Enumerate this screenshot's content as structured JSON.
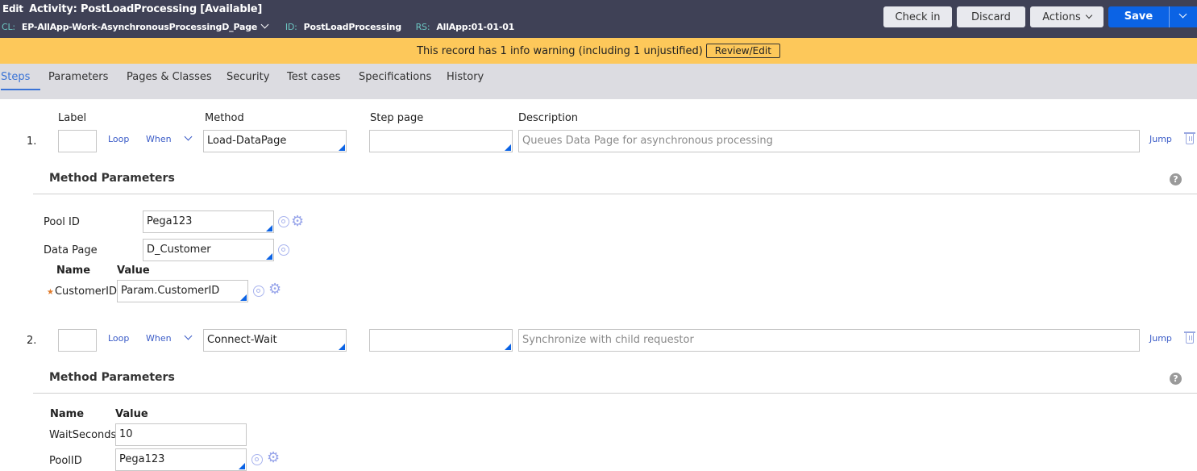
{
  "header": {
    "edit_label": "Edit",
    "title": "Activity: PostLoadProcessing [Available]",
    "cl_key": "CL:",
    "cl_value": "EP-AllApp-Work-AsynchronousProcessingD_Page",
    "id_key": "ID:",
    "id_value": "PostLoadProcessing",
    "rs_key": "RS:",
    "rs_value": "AllApp:01-01-01",
    "buttons": {
      "check_in": "Check in",
      "discard": "Discard",
      "actions": "Actions",
      "save": "Save"
    },
    "colors": {
      "background": "#3f4156",
      "save": "#0b63e5"
    }
  },
  "warning": {
    "text": "This record has 1 info warning (including 1 unjustified)",
    "button": "Review/Edit",
    "color": "#fdc85a"
  },
  "tabs": [
    {
      "label": "Steps",
      "active": true
    },
    {
      "label": "Parameters",
      "active": false
    },
    {
      "label": "Pages & Classes",
      "active": false
    },
    {
      "label": "Security",
      "active": false
    },
    {
      "label": "Test cases",
      "active": false
    },
    {
      "label": "Specifications",
      "active": false
    },
    {
      "label": "History",
      "active": false
    }
  ],
  "columns": {
    "label": "Label",
    "method": "Method",
    "step_page": "Step page",
    "description": "Description"
  },
  "steps": [
    {
      "number": "1.",
      "label_value": "",
      "loop": "Loop",
      "when": "When",
      "method": "Load-DataPage",
      "step_page": "",
      "description_placeholder": "Queues Data Page for asynchronous processing",
      "jump": "Jump",
      "method_parameters": {
        "title": "Method Parameters",
        "fields": [
          {
            "label": "Pool ID",
            "value": "Pega123"
          },
          {
            "label": "Data Page",
            "value": "D_Customer"
          }
        ],
        "name_header": "Name",
        "value_header": "Value",
        "params": [
          {
            "name": "CustomerID",
            "required": true,
            "value": "Param.CustomerID"
          }
        ]
      }
    },
    {
      "number": "2.",
      "label_value": "",
      "loop": "Loop",
      "when": "When",
      "method": "Connect-Wait",
      "step_page": "",
      "description_placeholder": "Synchronize with child requestor",
      "jump": "Jump",
      "method_parameters": {
        "title": "Method Parameters",
        "name_header": "Name",
        "value_header": "Value",
        "params": [
          {
            "name": "WaitSeconds",
            "required": false,
            "value": "10"
          },
          {
            "name": "PoolID",
            "required": false,
            "value": "Pega123"
          }
        ]
      }
    }
  ],
  "icons": {
    "star": "★",
    "gear": "⚙",
    "help": "?"
  }
}
